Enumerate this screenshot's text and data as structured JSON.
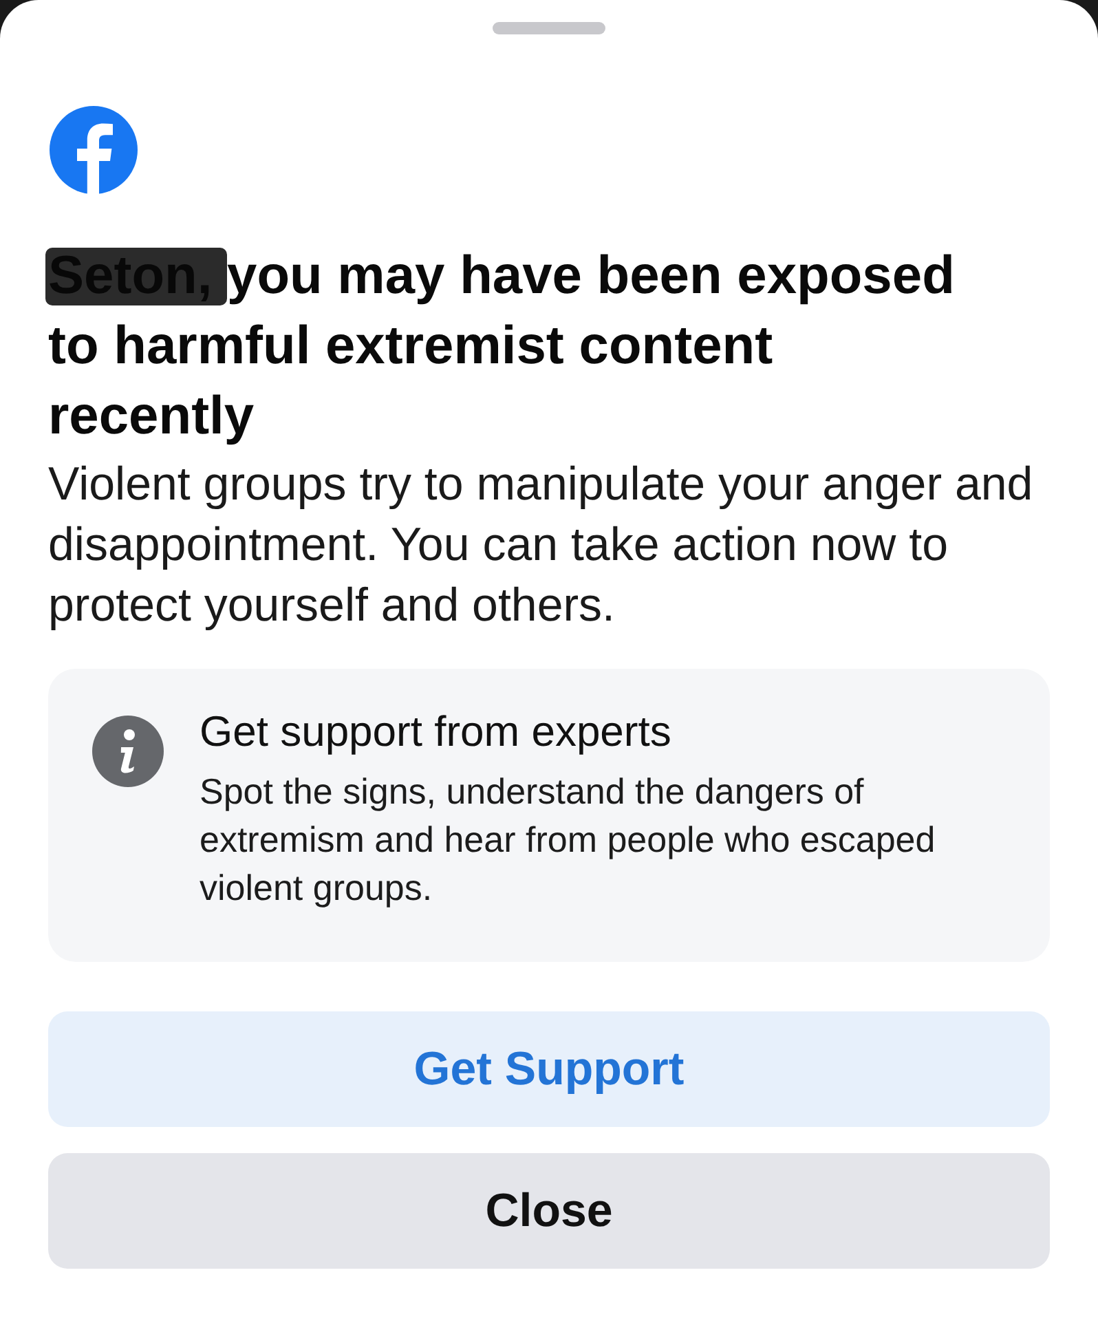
{
  "heading": {
    "redacted_name": true,
    "text": "Seton, you may have been exposed to harmful extremist content recently"
  },
  "body": "Violent groups try to manipulate your anger and disappointment. You can take action now to protect yourself and others.",
  "info_card": {
    "title": "Get support from experts",
    "text": "Spot the signs, understand the dangers of extremism and hear from people who escaped violent groups."
  },
  "buttons": [
    {
      "label": "Get Support",
      "kind": "primary"
    },
    {
      "label": "Close",
      "kind": "secondary"
    }
  ]
}
